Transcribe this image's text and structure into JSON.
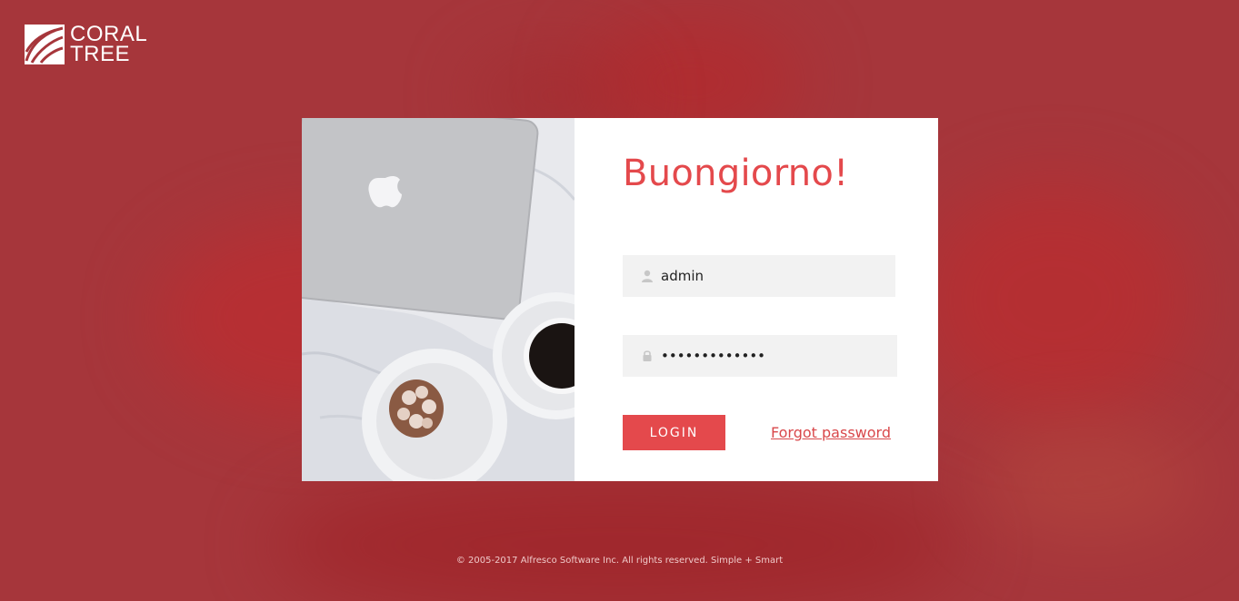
{
  "brand": {
    "line1": "CORAL",
    "line2": "TREE"
  },
  "login": {
    "greeting": "Buongiorno!",
    "username_value": "admin",
    "password_value": "•••••••••••••",
    "login_label": "LOGIN",
    "forgot_label": "Forgot password"
  },
  "icons": {
    "username": "user-icon",
    "password": "lock-icon"
  },
  "footer": {
    "text": "© 2005-2017 Alfresco Software Inc. All rights reserved. Simple + Smart"
  },
  "colors": {
    "background": "#a6363b",
    "accent": "#e4494c",
    "field": "#f2f2f2"
  }
}
